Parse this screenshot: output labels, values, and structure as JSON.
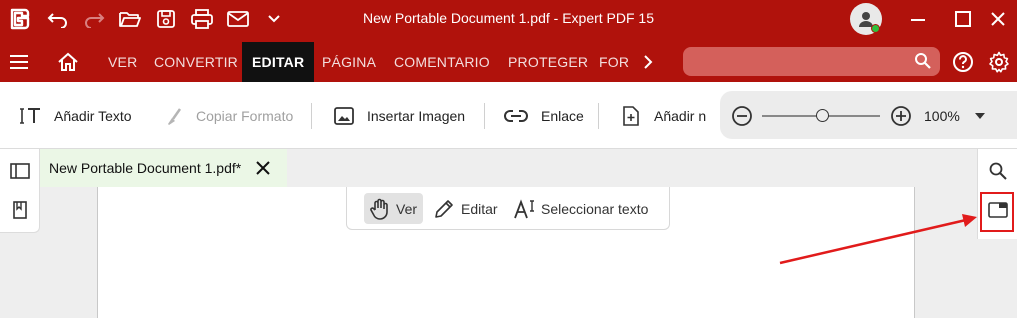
{
  "app": {
    "title": "New Portable Document 1.pdf - Expert PDF 15",
    "logo_icon": "expert-pdf-logo-icon",
    "quick_access": [
      "undo-icon",
      "redo-icon",
      "open-folder-icon",
      "save-icon",
      "print-icon",
      "email-icon",
      "chevron-down-icon"
    ],
    "window_controls": [
      "minimize-icon",
      "maximize-icon",
      "close-icon"
    ]
  },
  "menu": {
    "home_icon": "home-icon",
    "tabs": [
      "VER",
      "CONVERTIR",
      "EDITAR",
      "PÁGINA",
      "COMENTARIO",
      "PROTEGER",
      "FOR"
    ],
    "active_tab": "EDITAR",
    "search_placeholder": "",
    "search_value": ""
  },
  "toolbar": {
    "add_text": "Añadir Texto",
    "copy_format": "Copiar Formato",
    "insert_image": "Insertar Imagen",
    "link": "Enlace",
    "add_more": "Añadir n",
    "zoom_value": "100%",
    "zoom_level": 0.5
  },
  "document_tab": {
    "label": "New Portable Document 1.pdf*"
  },
  "mode_bar": {
    "view": "Ver",
    "edit": "Editar",
    "select_text": "Seleccionar texto",
    "active": "view"
  },
  "colors": {
    "brand": "#b0120c",
    "active_tab": "#111111",
    "tab_bg": "#ebf7e6",
    "annotation": "#e11b1b",
    "status_online": "#2fbf3c"
  }
}
